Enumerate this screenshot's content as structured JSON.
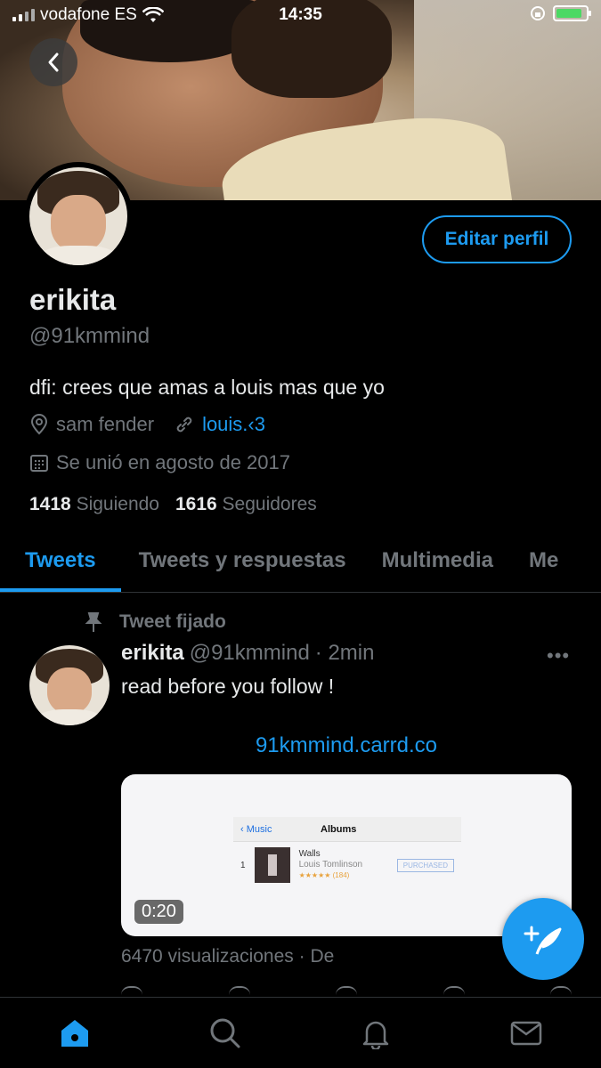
{
  "status_bar": {
    "carrier": "vodafone ES",
    "time": "14:35"
  },
  "profile": {
    "display_name": "erikita",
    "handle": "@91kmmind",
    "bio": "dfi: crees que amas a louis mas que yo",
    "location": "sam fender",
    "website": "louis.‹3",
    "joined": "Se unió en agosto de 2017",
    "following_count": "1418",
    "following_label": "Siguiendo",
    "followers_count": "1616",
    "followers_label": "Seguidores",
    "edit_button": "Editar perfil"
  },
  "tabs": [
    {
      "label": "Tweets",
      "active": true
    },
    {
      "label": "Tweets y respuestas",
      "active": false
    },
    {
      "label": "Multimedia",
      "active": false
    },
    {
      "label": "Me",
      "active": false
    }
  ],
  "pinned_tweet": {
    "pinned_label": "Tweet fijado",
    "author_name": "erikita",
    "author_handle": "@91kmmind",
    "time": "· 2min",
    "text": "read before you follow !",
    "link": "91kmmind.carrd.co",
    "video": {
      "duration": "0:20",
      "mock_back": "Music",
      "mock_title": "Albums",
      "mock_index": "1",
      "mock_album": "Walls",
      "mock_artist": "Louis Tomlinson",
      "mock_rating": "★★★★★ (184)",
      "mock_status": "PURCHASED"
    },
    "views": "6470 visualizaciones · De"
  },
  "colors": {
    "accent": "#1d9bf0",
    "muted": "#71767b",
    "text": "#e7e9ea",
    "background": "#000000"
  },
  "icons": {
    "back": "chevron-left-icon",
    "location": "map-pin-icon",
    "link": "link-icon",
    "calendar": "calendar-icon",
    "pin": "pin-icon",
    "more": "more-dots-icon",
    "compose": "compose-feather-icon",
    "nav": [
      "home-icon",
      "search-icon",
      "bell-icon",
      "mail-icon"
    ]
  }
}
